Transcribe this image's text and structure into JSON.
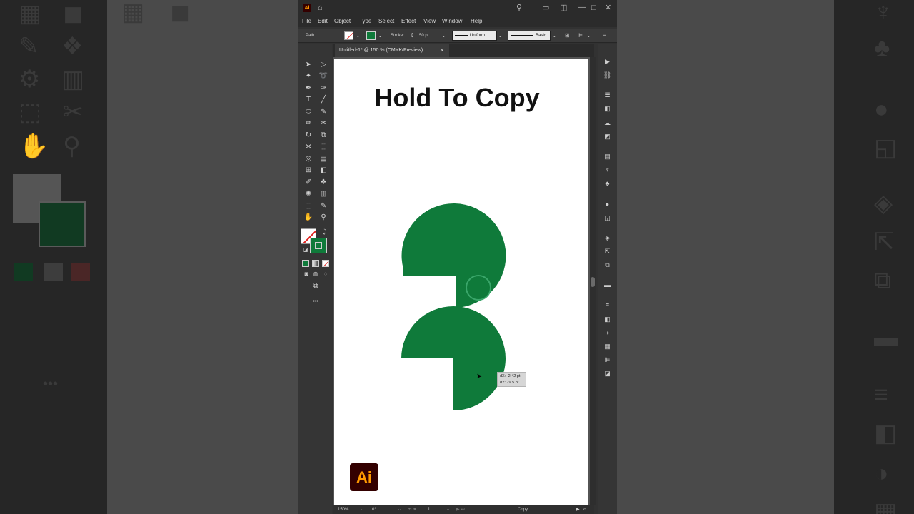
{
  "app": {
    "badge": "Ai",
    "menus": [
      "File",
      "Edit",
      "Object",
      "Type",
      "Select",
      "Effect",
      "View",
      "Window",
      "Help"
    ],
    "window_controls": {
      "minimize": "—",
      "maximize": "□",
      "close": "✕"
    }
  },
  "control_bar": {
    "selection_label": "Path",
    "stroke_label": "Stroke:",
    "stroke_value": "50 pt",
    "profile_label": "Uniform",
    "brush_label": "Basic"
  },
  "document": {
    "tab_title": "Untitled-1* @ 150 % (CMYK/Preview)",
    "tab_close": "×"
  },
  "artboard": {
    "headline": "Hold To Copy",
    "shape_color": "#0f7a3a",
    "tooltip": {
      "dx": "dX: -2.42 pt",
      "dy": "dY: 79.5 pt"
    },
    "logo": "Ai"
  },
  "status_bar": {
    "zoom": "150%",
    "rotation": "0°",
    "artboard_number": "1",
    "status": "Copy"
  },
  "colors": {
    "fill": "none",
    "stroke": "#0f7a3a",
    "brand_logo_bg": "#330000",
    "brand_logo_fg": "#ff9a00"
  },
  "toolbar": {
    "more_tools": "•••"
  }
}
